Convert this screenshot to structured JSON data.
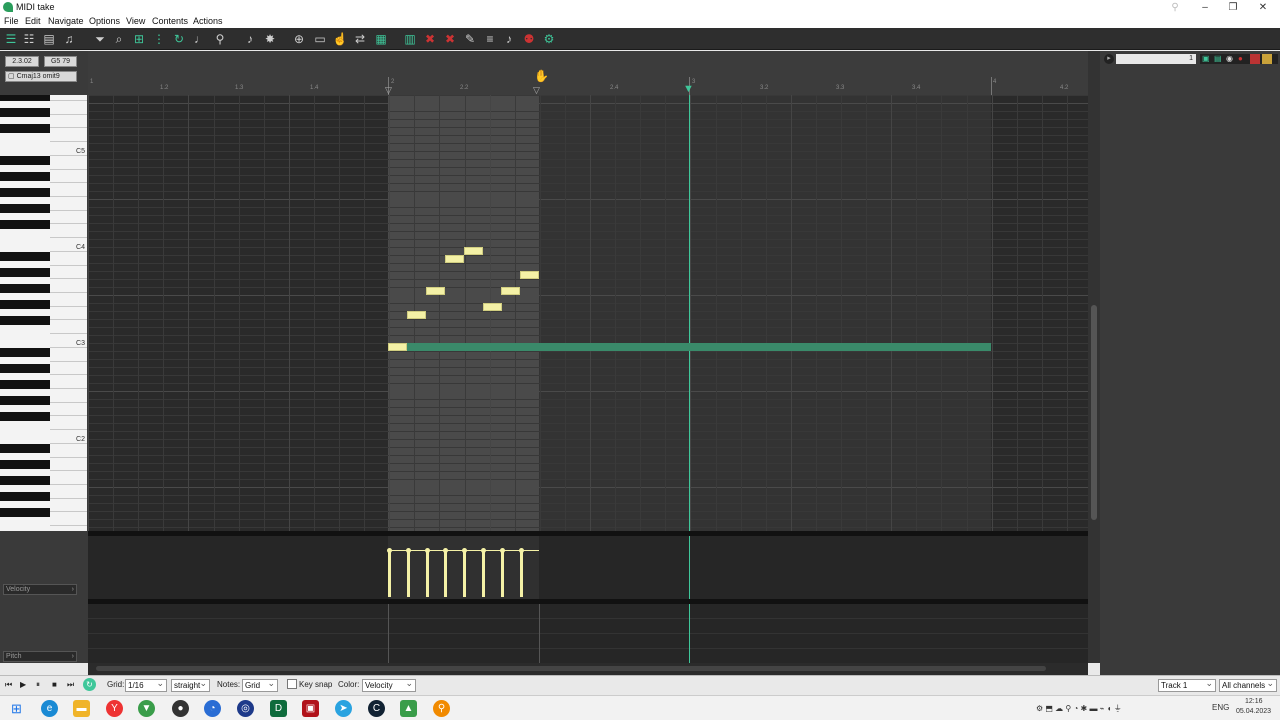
{
  "window": {
    "title": "MIDI take"
  },
  "menu": [
    "File",
    "Edit",
    "Navigate",
    "Options",
    "View",
    "Contents",
    "Actions"
  ],
  "left_panel": {
    "position_chip": "2.3.02",
    "note_chip": "G5 79",
    "chord_chip": "Cmaj13 omit9"
  },
  "piano_labels": {
    "c5": "C5",
    "c4": "C4",
    "c3": "C3",
    "c2": "C2"
  },
  "ruler_labels": {
    "m1": "1",
    "m1_2": "1.2",
    "m1_3": "1.3",
    "m1_4": "1.4",
    "m2": "2",
    "m2_2": "2.2",
    "m2_4": "2.4",
    "m3": "3",
    "m3_2": "3.2",
    "m3_3": "3.3",
    "m3_4": "3.4",
    "m4": "4",
    "m4_2": "4.2"
  },
  "lanes": {
    "velocity": "Velocity",
    "pitch": "Pitch"
  },
  "track_list": {
    "track_number": "1"
  },
  "bottom": {
    "grid_label": "Grid:",
    "grid_value": "1/16",
    "swing_value": "straight",
    "notes_label": "Notes:",
    "notes_value": "Grid",
    "key_snap_label": "Key snap",
    "color_label": "Color:",
    "color_value": "Velocity",
    "track_value": "Track 1",
    "channels_value": "All channels"
  },
  "taskbar": {
    "language": "ENG",
    "time": "12:16",
    "date": "05.04.2023"
  }
}
